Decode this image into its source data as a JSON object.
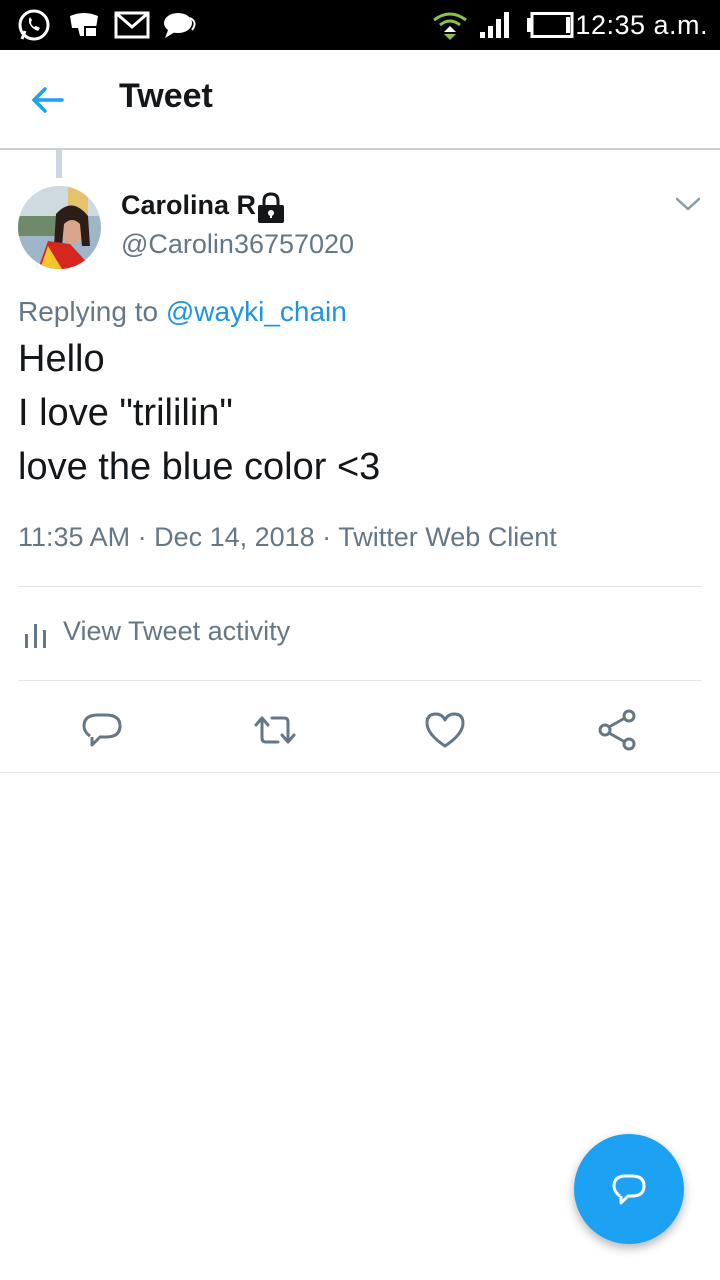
{
  "status_bar": {
    "time": "12:35 a.m.",
    "icons": [
      "whatsapp-icon",
      "game-icon",
      "gmail-icon",
      "chat-icon",
      "wifi-icon",
      "signal-icon",
      "battery-icon"
    ]
  },
  "header": {
    "title": "Tweet",
    "back_icon": "arrow-left-icon"
  },
  "tweet": {
    "author_name": "Carolina R",
    "author_handle": "@Carolin36757020",
    "protected_icon": "lock-icon",
    "reply_prefix": "Replying to",
    "reply_to": "@wayki_chain",
    "lines": [
      "Hello",
      "I love \"trililin\"",
      "love the blue color <3"
    ],
    "meta": "11:35 AM · Dec 14, 2018 · Twitter Web Client",
    "activity_label": "View Tweet activity"
  },
  "actions": [
    "reply-icon",
    "retweet-icon",
    "like-icon",
    "share-icon"
  ],
  "colors": {
    "accent": "#1da1f2",
    "link": "#1b95e0",
    "text_primary": "#14171a",
    "text_secondary": "#657786"
  }
}
